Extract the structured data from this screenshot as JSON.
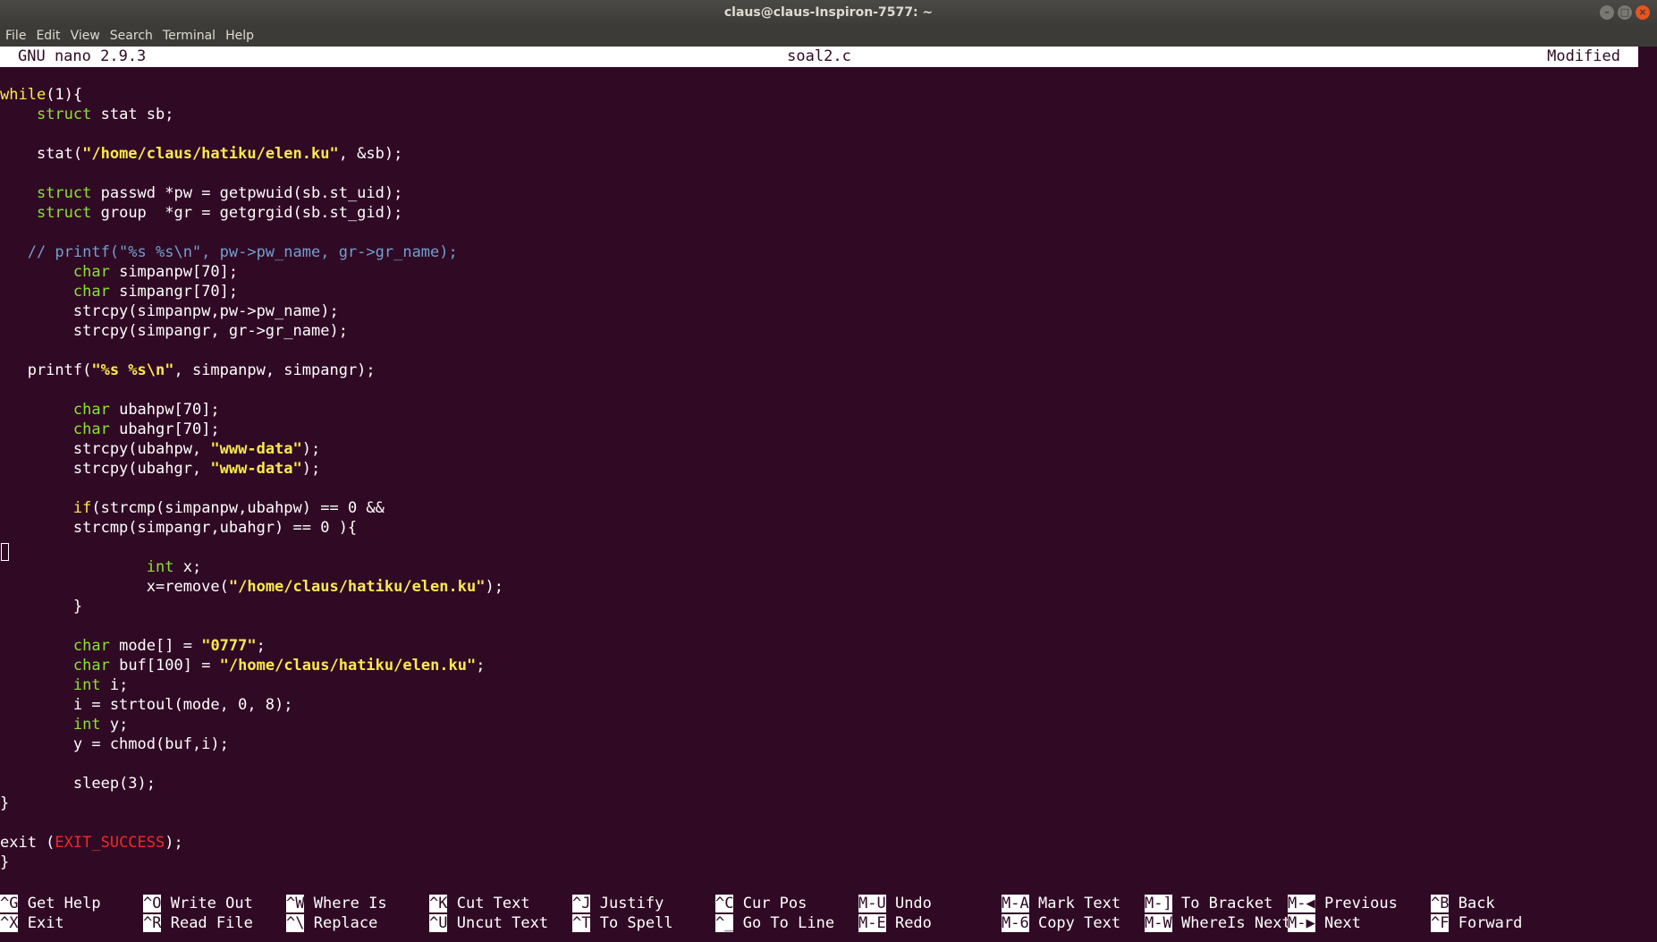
{
  "window": {
    "title": "claus@claus-Inspiron-7577: ~",
    "menu": [
      "File",
      "Edit",
      "View",
      "Search",
      "Terminal",
      "Help"
    ]
  },
  "nano": {
    "version": "GNU nano 2.9.3",
    "filename": "soal2.c",
    "status": "Modified"
  },
  "code_lines": [
    [
      {
        "t": "kw",
        "s": "while"
      },
      {
        "s": "(1){"
      }
    ],
    [
      {
        "s": "    "
      },
      {
        "t": "type",
        "s": "struct"
      },
      {
        "s": " stat sb;"
      }
    ],
    [],
    [
      {
        "s": "    stat("
      },
      {
        "t": "str",
        "s": "\"/home/claus/hatiku/elen.ku\""
      },
      {
        "s": ", &sb);"
      }
    ],
    [],
    [
      {
        "s": "    "
      },
      {
        "t": "type",
        "s": "struct"
      },
      {
        "s": " passwd *pw = getpwuid(sb.st_uid);"
      }
    ],
    [
      {
        "s": "    "
      },
      {
        "t": "type",
        "s": "struct"
      },
      {
        "s": " group  *gr = getgrgid(sb.st_gid);"
      }
    ],
    [],
    [
      {
        "t": "cmt",
        "s": "   // printf(\"%s %s\\n\", pw->pw_name, gr->gr_name);"
      }
    ],
    [
      {
        "s": "        "
      },
      {
        "t": "type",
        "s": "char"
      },
      {
        "s": " simpanpw[70];"
      }
    ],
    [
      {
        "s": "        "
      },
      {
        "t": "type",
        "s": "char"
      },
      {
        "s": " simpangr[70];"
      }
    ],
    [
      {
        "s": "        strcpy(simpanpw,pw->pw_name);"
      }
    ],
    [
      {
        "s": "        strcpy(simpangr, gr->gr_name);"
      }
    ],
    [],
    [
      {
        "s": "   printf("
      },
      {
        "t": "str",
        "s": "\"%s %s\\n\""
      },
      {
        "s": ", simpanpw, simpangr);"
      }
    ],
    [],
    [
      {
        "s": "        "
      },
      {
        "t": "type",
        "s": "char"
      },
      {
        "s": " ubahpw[70];"
      }
    ],
    [
      {
        "s": "        "
      },
      {
        "t": "type",
        "s": "char"
      },
      {
        "s": " ubahgr[70];"
      }
    ],
    [
      {
        "s": "        strcpy(ubahpw, "
      },
      {
        "t": "str",
        "s": "\"www-data\""
      },
      {
        "s": ");"
      }
    ],
    [
      {
        "s": "        strcpy(ubahgr, "
      },
      {
        "t": "str",
        "s": "\"www-data\""
      },
      {
        "s": ");"
      }
    ],
    [],
    [
      {
        "s": "        "
      },
      {
        "t": "kw",
        "s": "if"
      },
      {
        "s": "(strcmp(simpanpw,ubahpw) == 0 &&"
      }
    ],
    [
      {
        "s": "        strcmp(simpangr,ubahgr) == 0 ){"
      }
    ],
    [],
    [
      {
        "s": "                "
      },
      {
        "t": "type",
        "s": "int"
      },
      {
        "s": " x;"
      }
    ],
    [
      {
        "s": "                x=remove("
      },
      {
        "t": "str",
        "s": "\"/home/claus/hatiku/elen.ku\""
      },
      {
        "s": ");"
      }
    ],
    [
      {
        "s": "        }"
      }
    ],
    [],
    [
      {
        "s": "        "
      },
      {
        "t": "type",
        "s": "char"
      },
      {
        "s": " mode[] = "
      },
      {
        "t": "str",
        "s": "\"0777\""
      },
      {
        "s": ";"
      }
    ],
    [
      {
        "s": "        "
      },
      {
        "t": "type",
        "s": "char"
      },
      {
        "s": " buf[100] = "
      },
      {
        "t": "str",
        "s": "\"/home/claus/hatiku/elen.ku\""
      },
      {
        "s": ";"
      }
    ],
    [
      {
        "s": "        "
      },
      {
        "t": "type",
        "s": "int"
      },
      {
        "s": " i;"
      }
    ],
    [
      {
        "s": "        i = strtoul(mode, 0, 8);"
      }
    ],
    [
      {
        "s": "        "
      },
      {
        "t": "type",
        "s": "int"
      },
      {
        "s": " y;"
      }
    ],
    [
      {
        "s": "        y = chmod(buf,i);"
      }
    ],
    [],
    [
      {
        "s": "        sleep(3);"
      }
    ],
    [
      {
        "s": "}"
      }
    ],
    [],
    [
      {
        "s": "exit ("
      },
      {
        "t": "mac",
        "s": "EXIT_SUCCESS"
      },
      {
        "s": ");"
      }
    ],
    [
      {
        "s": "}"
      }
    ]
  ],
  "shortcuts": [
    [
      {
        "key": "^G",
        "label": "Get Help"
      },
      {
        "key": "^X",
        "label": "Exit"
      }
    ],
    [
      {
        "key": "^O",
        "label": "Write Out"
      },
      {
        "key": "^R",
        "label": "Read File"
      }
    ],
    [
      {
        "key": "^W",
        "label": "Where Is"
      },
      {
        "key": "^\\",
        "label": "Replace"
      }
    ],
    [
      {
        "key": "^K",
        "label": "Cut Text"
      },
      {
        "key": "^U",
        "label": "Uncut Text"
      }
    ],
    [
      {
        "key": "^J",
        "label": "Justify"
      },
      {
        "key": "^T",
        "label": "To Spell"
      }
    ],
    [
      {
        "key": "^C",
        "label": "Cur Pos"
      },
      {
        "key": "^_",
        "label": "Go To Line"
      }
    ],
    [
      {
        "key": "M-U",
        "label": "Undo"
      },
      {
        "key": "M-E",
        "label": "Redo"
      }
    ],
    [
      {
        "key": "M-A",
        "label": "Mark Text"
      },
      {
        "key": "M-6",
        "label": "Copy Text"
      }
    ],
    [
      {
        "key": "M-]",
        "label": "To Bracket"
      },
      {
        "key": "M-W",
        "label": "WhereIs Next"
      }
    ],
    [
      {
        "key": "M-◀",
        "label": "Previous"
      },
      {
        "key": "M-▶",
        "label": "Next"
      }
    ],
    [
      {
        "key": "^B",
        "label": "Back"
      },
      {
        "key": "^F",
        "label": "Forward"
      }
    ]
  ],
  "colors": {
    "terminal_bg": "#300a24",
    "keyword": "#fce94f",
    "type": "#8ae234",
    "comment": "#729fcf",
    "macro": "#ef2929"
  }
}
